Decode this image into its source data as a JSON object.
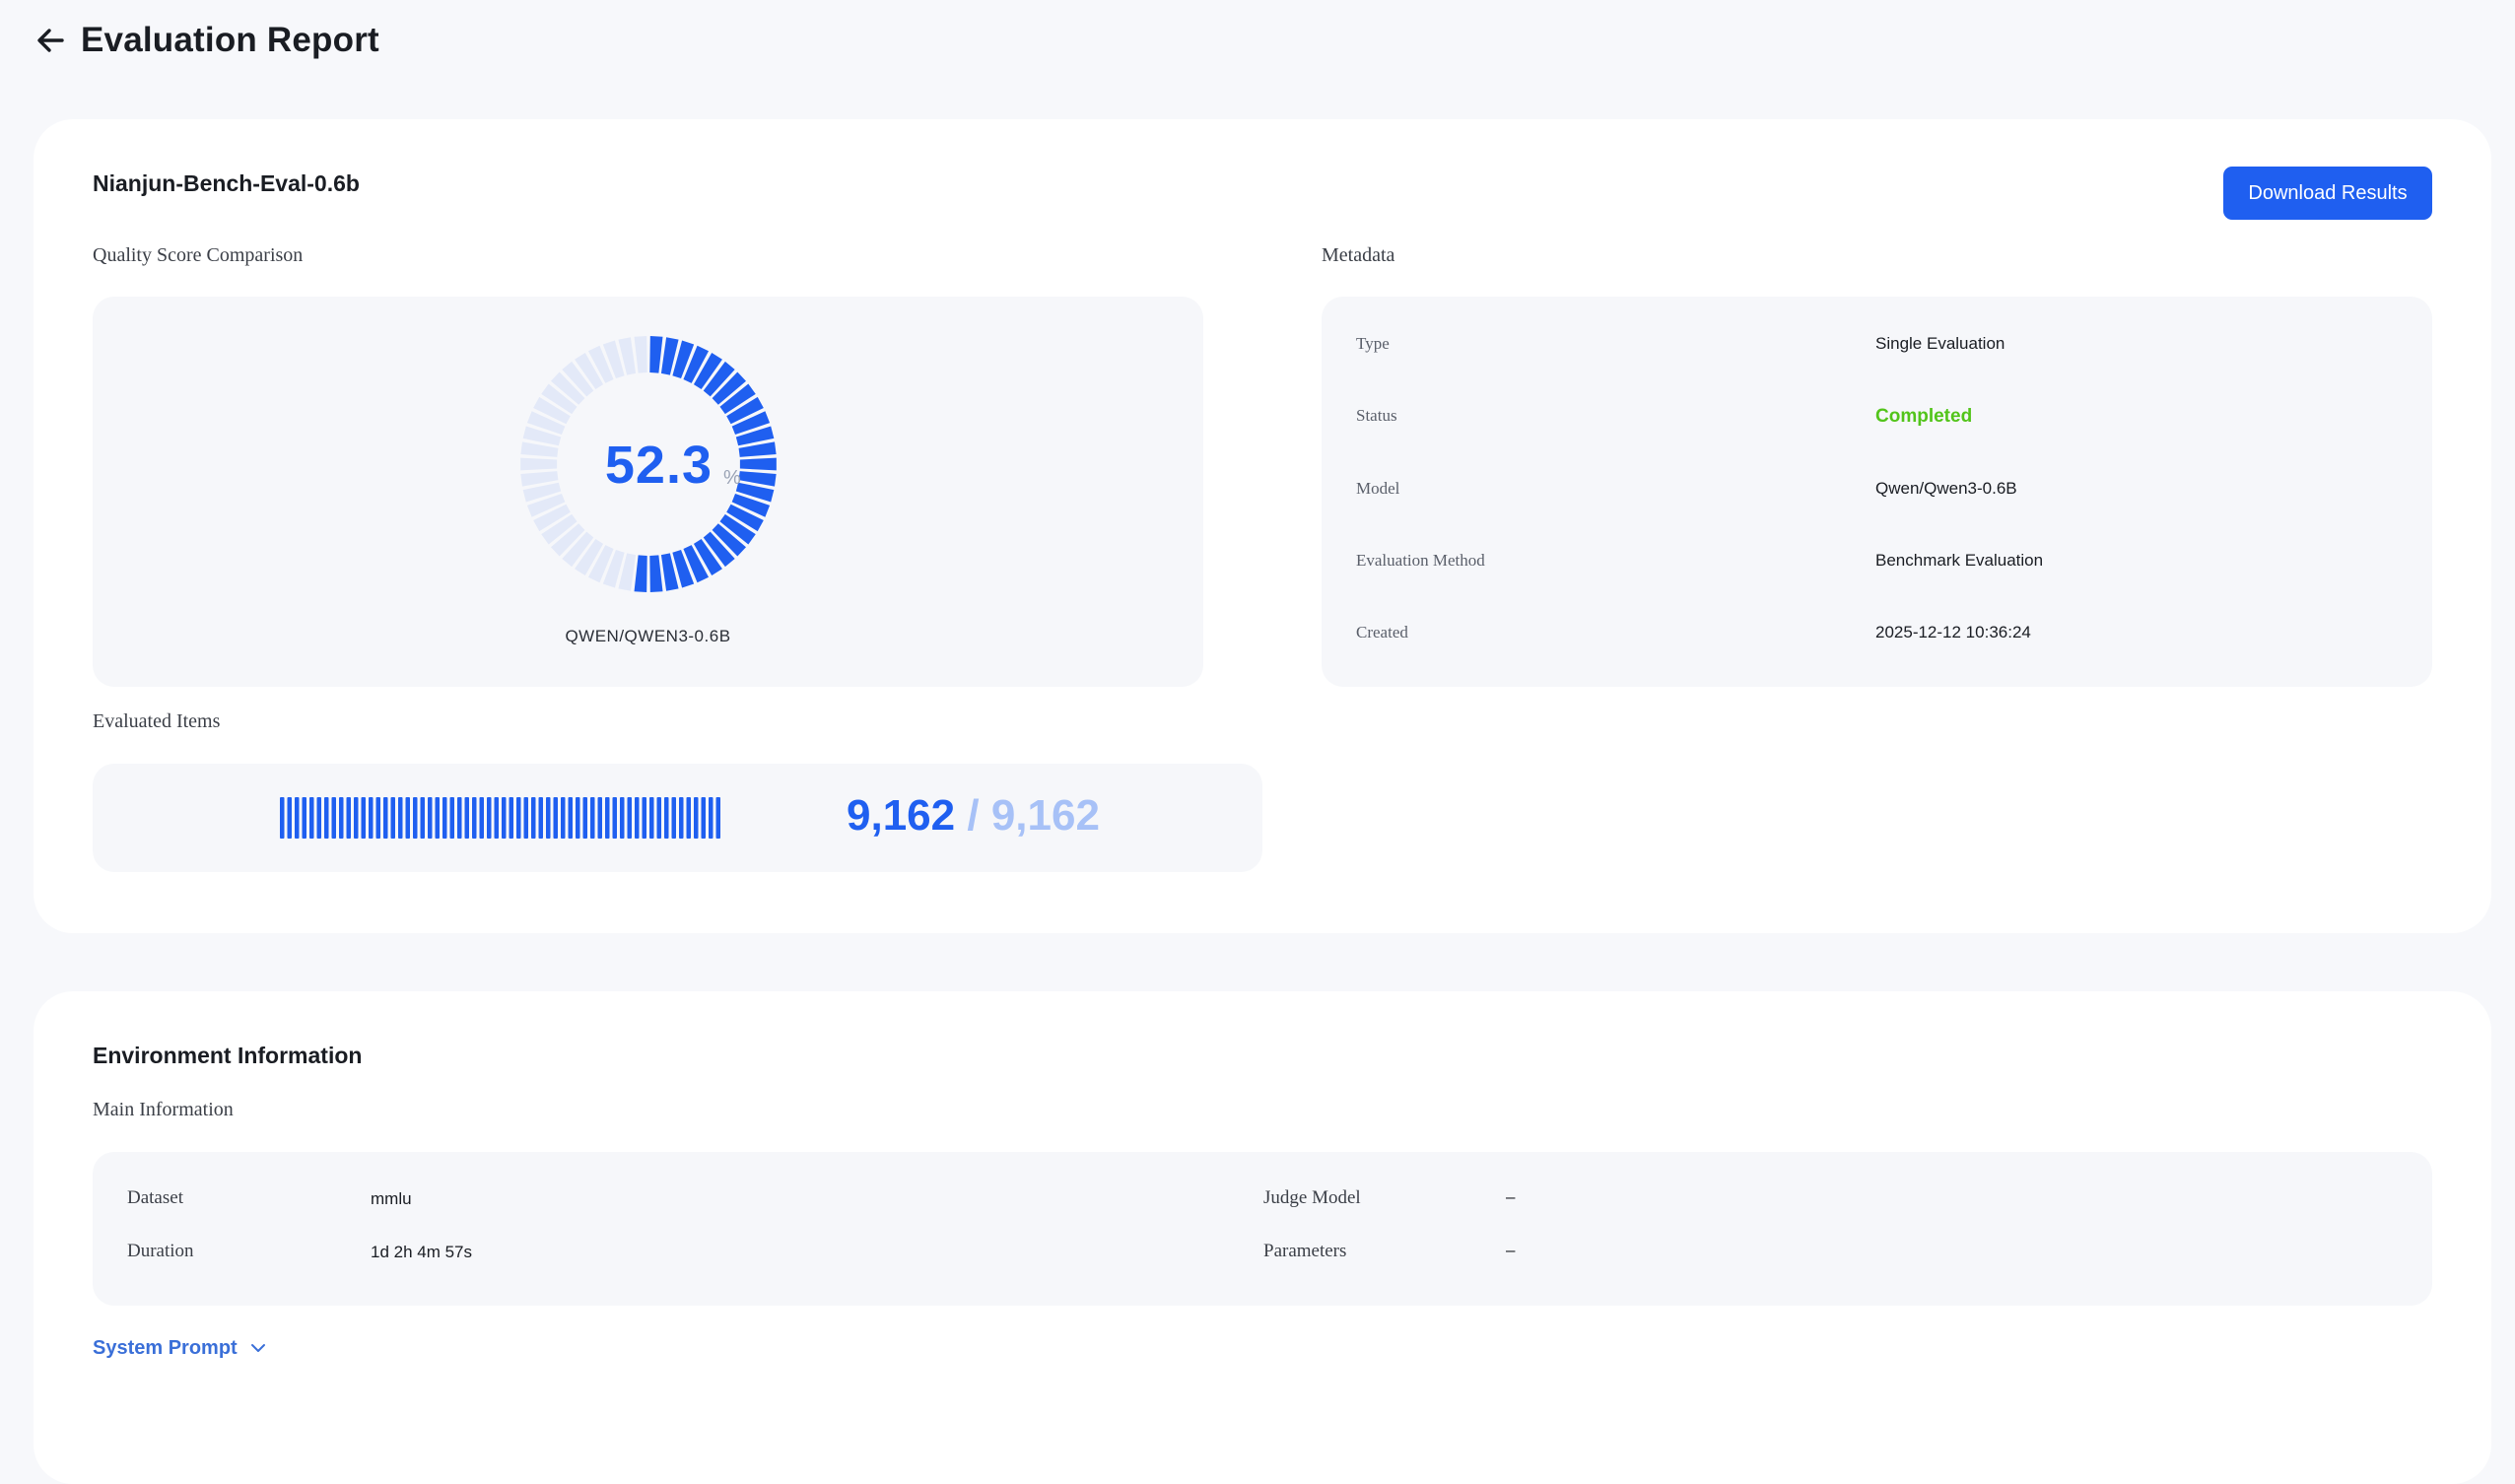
{
  "header": {
    "title": "Evaluation Report",
    "back_icon": "arrow-left-icon"
  },
  "evaluation": {
    "name": "Nianjun-Bench-Eval-0.6b",
    "download_label": "Download Results"
  },
  "quality": {
    "label": "Quality Score Comparison",
    "score": "52.3",
    "score_value": 52.3,
    "unit": "%",
    "model_label": "QWEN/QWEN3-0.6B",
    "colors": {
      "filled": "#1f5ff0",
      "empty": "#e3e9f8"
    }
  },
  "metadata": {
    "label": "Metadata",
    "rows": [
      {
        "key": "Type",
        "value": "Single Evaluation"
      },
      {
        "key": "Status",
        "value": "Completed"
      },
      {
        "key": "Model",
        "value": "Qwen/Qwen3-0.6B"
      },
      {
        "key": "Evaluation Method",
        "value": "Benchmark Evaluation"
      },
      {
        "key": "Created",
        "value": "2025-12-12 10:36:24"
      }
    ],
    "status_color": "#52c41a"
  },
  "items": {
    "label": "Evaluated Items",
    "done": "9,162",
    "separator": "/",
    "total": "9,162",
    "progress": 1.0
  },
  "environment": {
    "title": "Environment Information",
    "section_label": "Main Information",
    "dataset_key": "Dataset",
    "dataset_value": "mmlu",
    "duration_key": "Duration",
    "duration_value": "1d 2h 4m 57s",
    "judge_key": "Judge Model",
    "judge_value": "–",
    "params_key": "Parameters",
    "params_value": "–",
    "system_prompt_label": "System Prompt",
    "system_prompt_icon": "chevron-down-icon"
  },
  "colors": {
    "accent": "#1f5ff0",
    "accent_light": "#a7c1f7",
    "success": "#52c41a"
  }
}
